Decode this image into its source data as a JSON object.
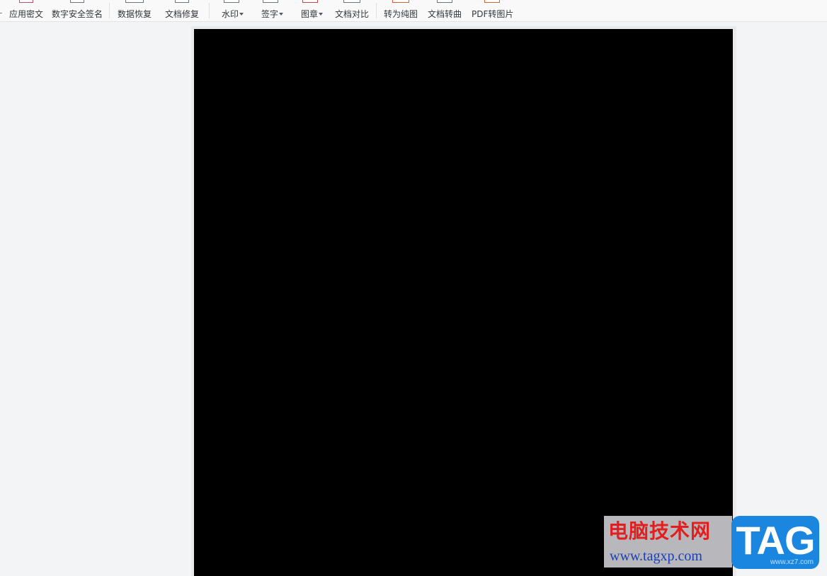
{
  "toolbar": {
    "items": [
      {
        "label": "应用密文"
      },
      {
        "label": "数字安全签名"
      },
      {
        "label": "数据恢复"
      },
      {
        "label": "文档修复"
      },
      {
        "label": "水印"
      },
      {
        "label": "签字"
      },
      {
        "label": "图章"
      },
      {
        "label": "文档对比"
      },
      {
        "label": "转为纯图"
      },
      {
        "label": "文档转曲"
      },
      {
        "label": "PDF转图片"
      }
    ]
  },
  "watermark": {
    "site_name": "电脑技术网",
    "url": "www.tagxp.com",
    "badge_text": "TAG",
    "badge_subtext": "www.xz7.com"
  },
  "colors": {
    "page": "#000000",
    "workspace": "#f3f4f6",
    "watermark_red": "#e31e1e",
    "watermark_blue": "#1a86e0"
  }
}
